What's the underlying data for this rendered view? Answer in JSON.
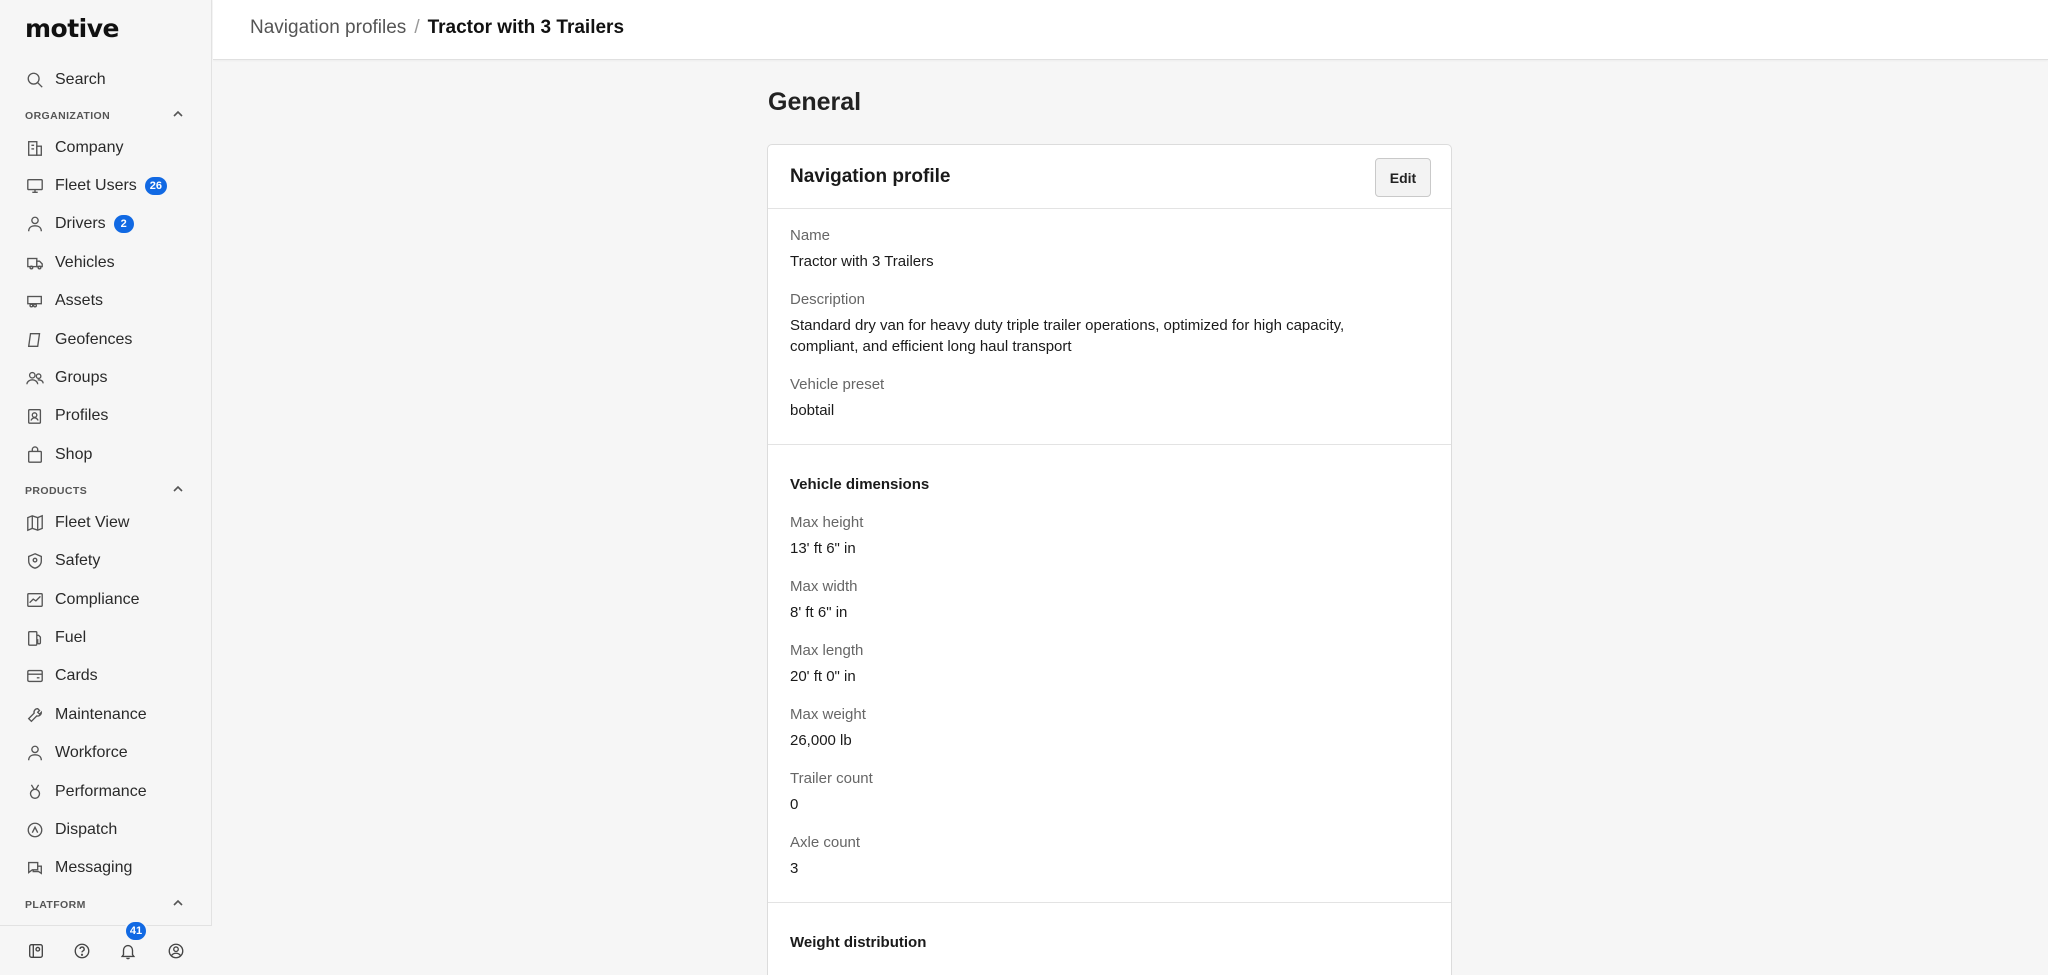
{
  "app": {
    "logo": "motive"
  },
  "sidebar": {
    "search_label": "Search",
    "organization_label": "ORGANIZATION",
    "organization_items": [
      {
        "label": "Company",
        "icon": "building-icon"
      },
      {
        "label": "Fleet Users",
        "icon": "monitor-icon",
        "badge": "26"
      },
      {
        "label": "Drivers",
        "icon": "person-icon",
        "badge": "2"
      },
      {
        "label": "Vehicles",
        "icon": "truck-icon"
      },
      {
        "label": "Assets",
        "icon": "trailer-icon"
      },
      {
        "label": "Geofences",
        "icon": "geofence-icon"
      },
      {
        "label": "Groups",
        "icon": "group-icon"
      },
      {
        "label": "Profiles",
        "icon": "profile-settings-icon"
      },
      {
        "label": "Shop",
        "icon": "shopping-bag-icon"
      }
    ],
    "products_label": "PRODUCTS",
    "products_items": [
      {
        "label": "Fleet View",
        "icon": "map-icon"
      },
      {
        "label": "Safety",
        "icon": "shield-icon"
      },
      {
        "label": "Compliance",
        "icon": "chart-icon"
      },
      {
        "label": "Fuel",
        "icon": "fuel-icon"
      },
      {
        "label": "Cards",
        "icon": "card-icon"
      },
      {
        "label": "Maintenance",
        "icon": "wrench-icon"
      },
      {
        "label": "Workforce",
        "icon": "person-icon"
      },
      {
        "label": "Performance",
        "icon": "medal-icon"
      },
      {
        "label": "Dispatch",
        "icon": "route-icon"
      },
      {
        "label": "Messaging",
        "icon": "message-icon"
      }
    ],
    "platform_label": "PLATFORM",
    "notifications_count": "41"
  },
  "header": {
    "breadcrumb_parent": "Navigation profiles",
    "breadcrumb_separator": "/",
    "breadcrumb_current": "Tractor with 3 Trailers"
  },
  "main": {
    "section_title": "General",
    "card_title": "Navigation profile",
    "edit_label": "Edit",
    "fields": {
      "name_label": "Name",
      "name_value": "Tractor with 3 Trailers",
      "description_label": "Description",
      "description_line1": "Standard dry van for heavy duty triple trailer operations, optimized for high capacity,",
      "description_line2": "compliant, and efficient long haul transport",
      "preset_label": "Vehicle preset",
      "preset_value": "bobtail"
    },
    "dimensions": {
      "title": "Vehicle dimensions",
      "max_height_label": "Max height",
      "max_height_value": "13' ft 6\" in",
      "max_width_label": "Max width",
      "max_width_value": "8' ft 6\" in",
      "max_length_label": "Max length",
      "max_length_value": "20' ft 0\" in",
      "max_weight_label": "Max weight",
      "max_weight_value": "26,000 lb",
      "trailer_count_label": "Trailer count",
      "trailer_count_value": "0",
      "axle_count_label": "Axle count",
      "axle_count_value": "3"
    },
    "weight_distribution": {
      "title": "Weight distribution"
    }
  }
}
